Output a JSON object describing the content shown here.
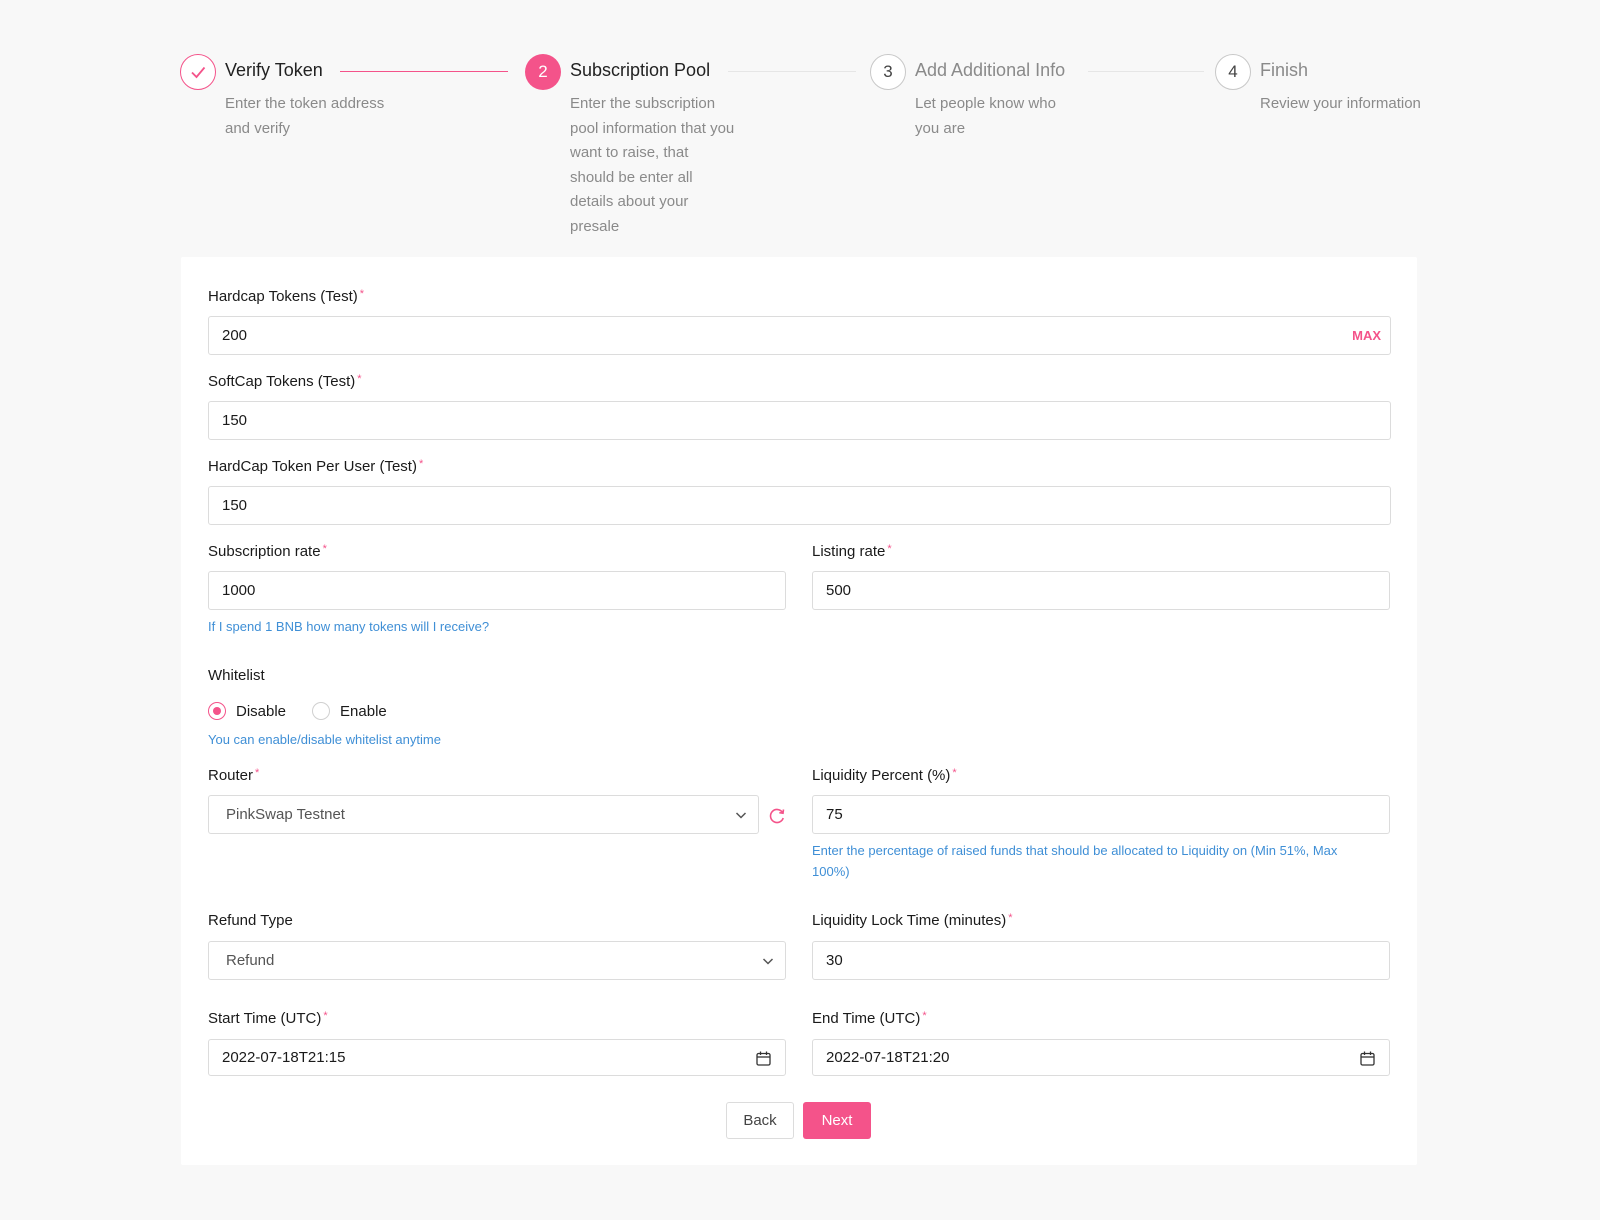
{
  "steps": [
    {
      "number": "1",
      "title": "Verify Token",
      "description": "Enter the token address and verify",
      "status": "done"
    },
    {
      "number": "2",
      "title": "Subscription Pool",
      "description": "Enter the subscription pool information that you want to raise, that should be enter all details about your presale",
      "status": "active"
    },
    {
      "number": "3",
      "title": "Add Additional Info",
      "description": "Let people know who you are",
      "status": "wait"
    },
    {
      "number": "4",
      "title": "Finish",
      "description": "Review your information",
      "status": "wait"
    }
  ],
  "form": {
    "hardcap": {
      "label": "Hardcap Tokens (Test)",
      "value": "200",
      "max_label": "MAX"
    },
    "softcap": {
      "label": "SoftCap Tokens (Test)",
      "value": "150"
    },
    "hardcap_per_user": {
      "label": "HardCap Token Per User (Test)",
      "value": "150"
    },
    "subscription_rate": {
      "label": "Subscription rate",
      "value": "1000",
      "help": "If I spend 1 BNB how many tokens will I receive?"
    },
    "listing_rate": {
      "label": "Listing rate",
      "value": "500"
    },
    "whitelist": {
      "label": "Whitelist",
      "options": [
        "Disable",
        "Enable"
      ],
      "selected": "Disable",
      "help": "You can enable/disable whitelist anytime"
    },
    "router": {
      "label": "Router",
      "value": "PinkSwap Testnet"
    },
    "liquidity_percent": {
      "label": "Liquidity Percent (%)",
      "value": "75",
      "help": "Enter the percentage of raised funds that should be allocated to Liquidity on (Min 51%, Max 100%)"
    },
    "refund_type": {
      "label": "Refund Type",
      "value": "Refund"
    },
    "liquidity_lock": {
      "label": "Liquidity Lock Time (minutes)",
      "value": "30"
    },
    "start_time": {
      "label": "Start Time (UTC)",
      "value": "2022-07-18T21:15"
    },
    "end_time": {
      "label": "End Time (UTC)",
      "value": "2022-07-18T21:20"
    },
    "required_mark": "*"
  },
  "buttons": {
    "back": "Back",
    "next": "Next"
  },
  "colors": {
    "accent": "#f4538a",
    "help_text": "#3f8fd6",
    "background": "#f8f8f8"
  },
  "icons": {
    "done_step": "check-icon",
    "select": "chevron-down-icon",
    "date": "calendar-icon",
    "refresh": "refresh-icon"
  }
}
